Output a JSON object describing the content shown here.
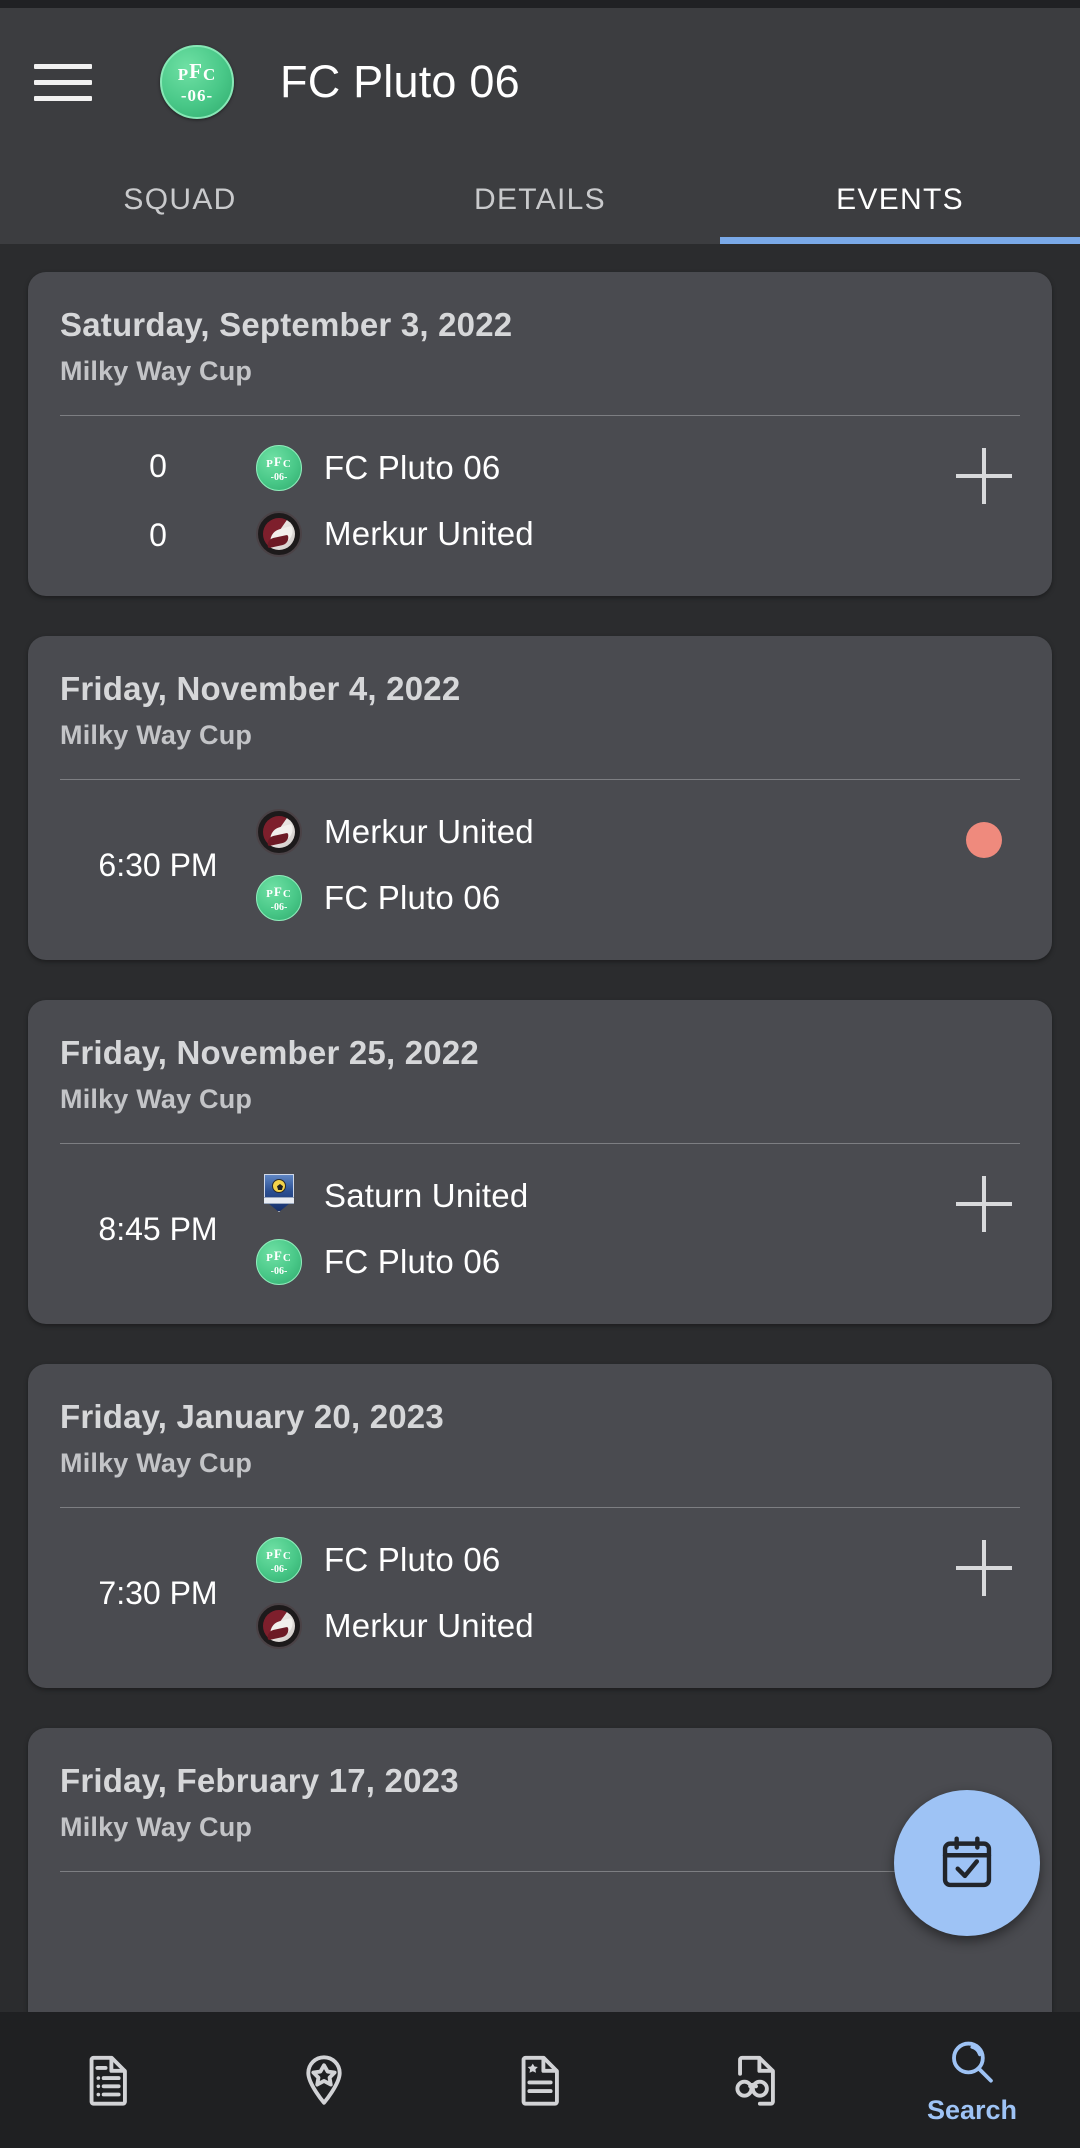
{
  "app": {
    "title": "FC Pluto 06",
    "menu_icon": "hamburger-menu-icon",
    "club_badge": {
      "line1_left": "P",
      "line1_mid": "F",
      "line1_right": "C",
      "line2": "-06-"
    }
  },
  "tabs": [
    {
      "label": "SQUAD",
      "active": false
    },
    {
      "label": "DETAILS",
      "active": false
    },
    {
      "label": "EVENTS",
      "active": true
    }
  ],
  "events": [
    {
      "date": "Saturday, September 3, 2022",
      "competition": "Milky Way Cup",
      "kickoff": "",
      "home_score": "0",
      "away_score": "0",
      "home_team": "FC Pluto 06",
      "away_team": "Merkur United",
      "home_crest": "pluto",
      "away_crest": "merkur",
      "action": "plus"
    },
    {
      "date": "Friday, November 4, 2022",
      "competition": "Milky Way Cup",
      "kickoff": "6:30 PM",
      "home_score": "",
      "away_score": "",
      "home_team": "Merkur United",
      "away_team": "FC Pluto 06",
      "home_crest": "merkur",
      "away_crest": "pluto",
      "action": "dot"
    },
    {
      "date": "Friday, November 25, 2022",
      "competition": "Milky Way Cup",
      "kickoff": "8:45 PM",
      "home_score": "",
      "away_score": "",
      "home_team": "Saturn United",
      "away_team": "FC Pluto 06",
      "home_crest": "saturn",
      "away_crest": "pluto",
      "action": "plus"
    },
    {
      "date": "Friday, January 20, 2023",
      "competition": "Milky Way Cup",
      "kickoff": "7:30 PM",
      "home_score": "",
      "away_score": "",
      "home_team": "FC Pluto 06",
      "away_team": "Merkur United",
      "home_crest": "pluto",
      "away_crest": "merkur",
      "action": "plus"
    },
    {
      "date": "Friday, February 17, 2023",
      "competition": "Milky Way Cup",
      "kickoff": "",
      "home_score": "",
      "away_score": "",
      "home_team": "",
      "away_team": "",
      "home_crest": "",
      "away_crest": "",
      "action": ""
    }
  ],
  "fab": {
    "icon": "calendar-check-icon"
  },
  "bottomnav": [
    {
      "icon": "document-list-icon",
      "label": "",
      "active": false
    },
    {
      "icon": "location-pin-star-icon",
      "label": "",
      "active": false
    },
    {
      "icon": "document-star-icon",
      "label": "",
      "active": false
    },
    {
      "icon": "document-binoculars-icon",
      "label": "",
      "active": false
    },
    {
      "icon": "search-icon",
      "label": "Search",
      "active": true
    }
  ],
  "colors": {
    "background": "#2b2c2e",
    "appbar": "#3c3d40",
    "card": "#4a4b50",
    "accent": "#7aa9e8",
    "fab": "#9ec3f5",
    "nav_active": "#9ec3f5",
    "status_dot": "#ef8a7d",
    "club_green": "#49c888"
  }
}
